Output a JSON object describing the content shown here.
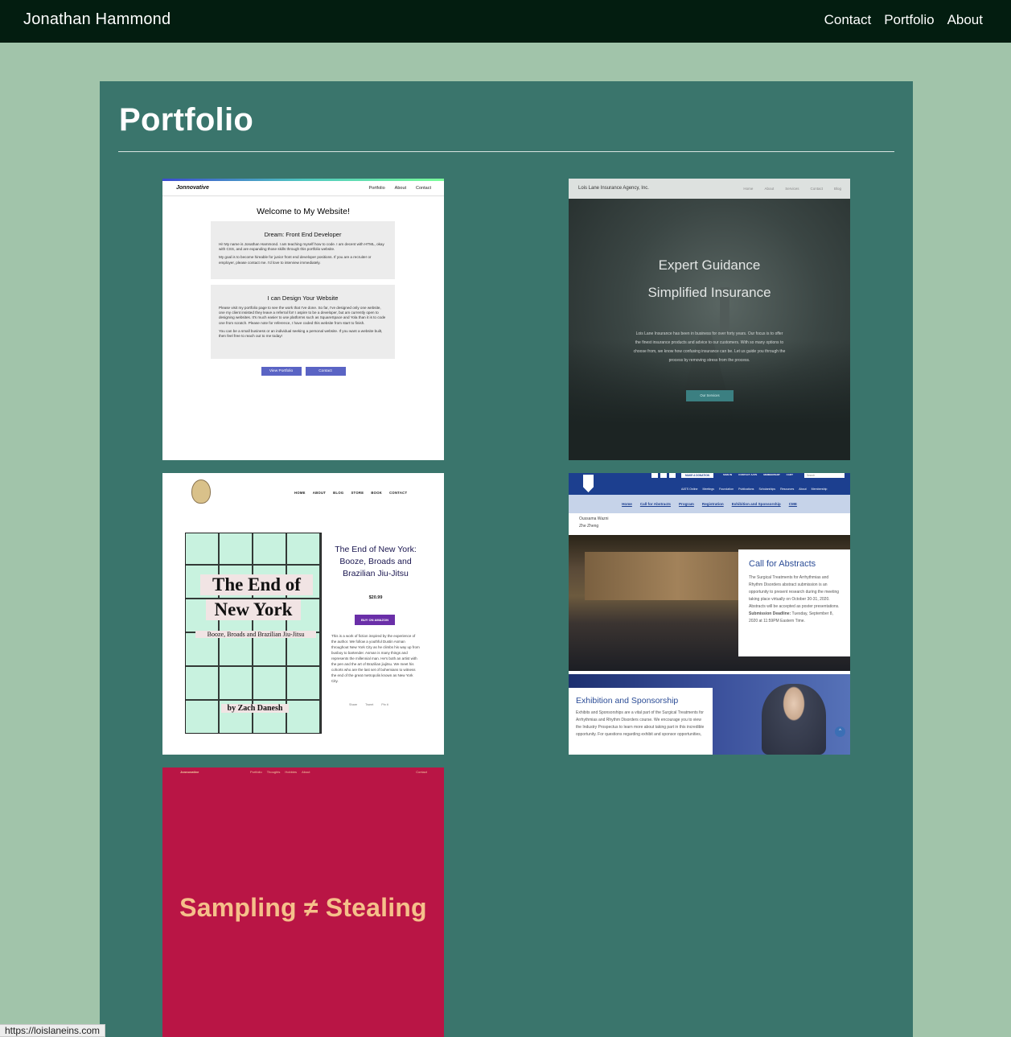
{
  "header": {
    "brand": "Jonathan Hammond",
    "nav": [
      "Contact",
      "Portfolio",
      "About"
    ]
  },
  "main": {
    "title": "Portfolio"
  },
  "thumbs": {
    "jonnovative": {
      "logo": "Jonnovative",
      "nav": [
        "Portfolio",
        "About",
        "Contact"
      ],
      "welcome": "Welcome to My Website!",
      "box1_title": "Dream: Front End Developer",
      "box1_p1": "Hi! My name is Jonathan Hammond. I am teaching myself how to code. I am decent with HTML, okay with CSS, and are expanding those skills through this portfolio website.",
      "box1_p2": "My goal is to become hireable for junior front end developer positions. If you are a recruiter or employer, please contact me. I'd love to interview immediately.",
      "box2_title": "I can Design Your Website",
      "box2_p1": "Please visit my portfolio page to see the work that I've done. So far, I've designed only one website, one my client insisted they leave a referral for! I aspire to be a developer, but am currently open to designing websites. It's much easier to use platforms such as SquareSpace and Yola than it is to code one from scratch. Please note for reference, I have coded this website from start to finish.",
      "box2_p2": "You can be a small business or an individual seeking a personal website. If you want a website built, then feel free to reach out to me today!",
      "btn_portfolio": "View Portfolio",
      "btn_contact": "Contact"
    },
    "loislane": {
      "name": "Lois Lane Insurance Agency, Inc.",
      "nav": [
        "Home",
        "About",
        "Services",
        "Contact",
        "Blog"
      ],
      "headline1": "Expert Guidance",
      "headline2": "Simplified Insurance",
      "blurb": "Lois Lane Insurance has been in business for over forty years. Our focus is to offer the finest insurance products and advice to our customers. With so many options to choose from, we know how confusing insurance can be. Let us guide you through the process by removing stress from the process.",
      "cta": "Our Services"
    },
    "endofny": {
      "nav": [
        "HOME",
        "ABOUT",
        "BLOG",
        "STORE",
        "BOOK",
        "CONTACT"
      ],
      "cover_line1": "The End of",
      "cover_line2": "New York",
      "cover_line3": "Booze, Broads and Brazilian Jiu-Jitsu",
      "cover_author": "by Zach Danesh",
      "title": "The End of New York: Booze, Broads and Brazilian Jiu-Jitsu",
      "price": "$20.99",
      "buy": "BUY ON AMAZON",
      "desc": "This is a work of fiction inspired by the experience of the author. We follow a youthful Dustin Asman throughout New York City as he climbs his way up from busboy to bartender. Asman is many things and represents the millennial man. He's both an artist with the pen and the art of Brazilian jiujitsu. We meet his cohorts who are the last set of bohemians to witness the end of the great metropolis known as New York City.",
      "share": [
        "Share",
        "Tweet",
        "Pin it"
      ]
    },
    "aats": {
      "donate": "MAKE A DONATION",
      "smalls": [
        "SIGN IN",
        "CONTACT AATS",
        "MEMBERSHIP",
        "CART"
      ],
      "search": "Search",
      "menu": [
        "AATS Online",
        "Meetings",
        "Foundation",
        "Publications",
        "Scholarships",
        "Resources",
        "About",
        "Membership"
      ],
      "sub": [
        "Home",
        "Call for Abstracts",
        "Program",
        "Registration",
        "Exhibition and Sponsorship",
        "CME"
      ],
      "name1": "Oussama Wazni",
      "name2": "Zhe Zheng",
      "cfa_title": "Call for Abstracts",
      "cfa_text": "The Surgical Treatments for Arrhythmias and Rhythm Disorders abstract submission is an opportunity to present research during the meeting taking place virtually on October 30-31, 2020. Abstracts will be accepted as poster presentations.",
      "cfa_deadline_label": "Submission Deadline:",
      "cfa_deadline": "Tuesday, September 8, 2020 at 11:59PM Eastern Time.",
      "ex_title": "Exhibition and Sponsorship",
      "ex_text": "Exhibits and Sponsorships are a vital part of the Surgical Treatments for Arrhythmias and Rhythm Disorders course. We encourage you to view the Industry Prospectus to learn more about taking part in this incredible opportunity. For questions regarding exhibit and sponsor opportunities,"
    },
    "sampling": {
      "brand": "Jonnovative",
      "nav": [
        "Portfolio",
        "Thoughts",
        "Hobbies",
        "About"
      ],
      "contact": "Contact",
      "headline": "Sampling ≠ Stealing"
    }
  },
  "status": {
    "url": "https://loislaneins.com"
  }
}
